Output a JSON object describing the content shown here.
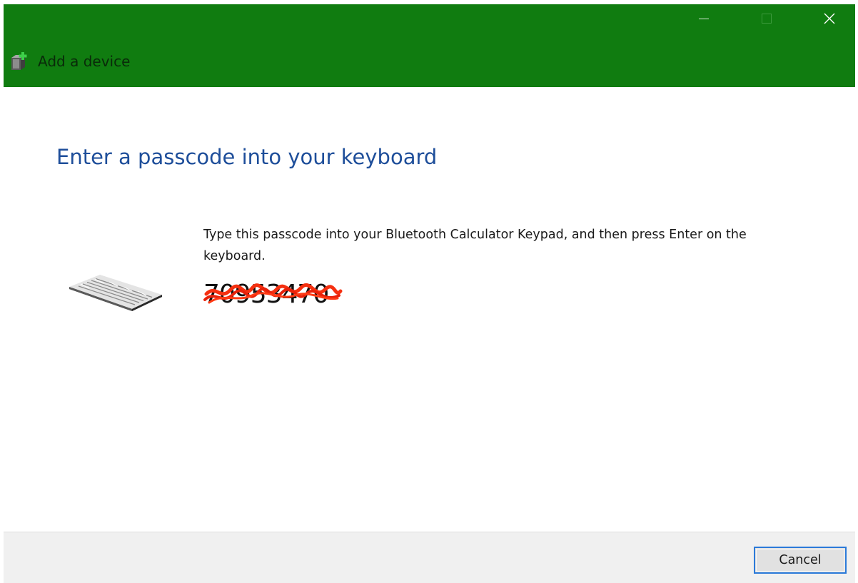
{
  "window": {
    "title": "Add a device",
    "icon": "add-device-icon",
    "titlebar_color": "#107c10",
    "controls": {
      "minimize": "minimize-icon",
      "maximize": "maximize-icon",
      "close": "close-icon"
    }
  },
  "main": {
    "heading": "Enter a passcode into your keyboard",
    "heading_color": "#1e4e9a",
    "instruction": "Type this passcode into your Bluetooth Calculator Keypad, and then press Enter on the keyboard.",
    "passcode": "70953470",
    "device_image": "keyboard-image"
  },
  "footer": {
    "cancel_label": "Cancel"
  }
}
